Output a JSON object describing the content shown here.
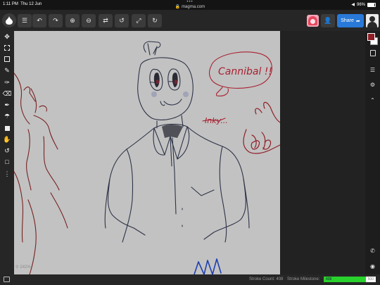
{
  "status_bar": {
    "time": "1:11 PM",
    "day": "Thu 12 Jun",
    "url": "magma.com",
    "dots": "•••",
    "battery": "96%"
  },
  "toolbar": {
    "menu_icon": "hamburger-menu-icon",
    "undo_icon": "undo-arrow-icon",
    "redo_icon": "redo-arrow-icon",
    "zoom_in_icon": "zoom-in-icon",
    "zoom_out_icon": "zoom-out-icon",
    "flip_icon": "flip-icon",
    "rotate_left_icon": "rotate-left-icon",
    "fit_icon": "fit-screen-icon",
    "rotate_right_icon": "rotate-right-icon",
    "share_label": "Share"
  },
  "left_tools": [
    "move",
    "select",
    "transform",
    "eyedropper",
    "brush",
    "eraser",
    "pencil",
    "fill",
    "shape",
    "hand",
    "rotate",
    "comment",
    "more"
  ],
  "right_panel": {
    "primary_color": "#8f1f27",
    "secondary_color": "#ffffff",
    "icons": [
      "swatches-icon",
      "layers-icon",
      "settings-icon",
      "collapse-chevron-icon",
      "phone-icon",
      "chat-icon"
    ]
  },
  "canvas": {
    "background": "#c2c2c2",
    "annotations": {
      "cannibal_text": "Cannibal !!",
      "inky_text": "Inky..."
    }
  },
  "zoom": {
    "icon": "magnify-icon",
    "level": "242%"
  },
  "footer": {
    "stroke_count_label": "Stroke Count: 408",
    "milestone_label": "Stroke Milestone:",
    "milestone_value": "408",
    "milestone_max": "500",
    "milestone_fraction": 0.816
  }
}
